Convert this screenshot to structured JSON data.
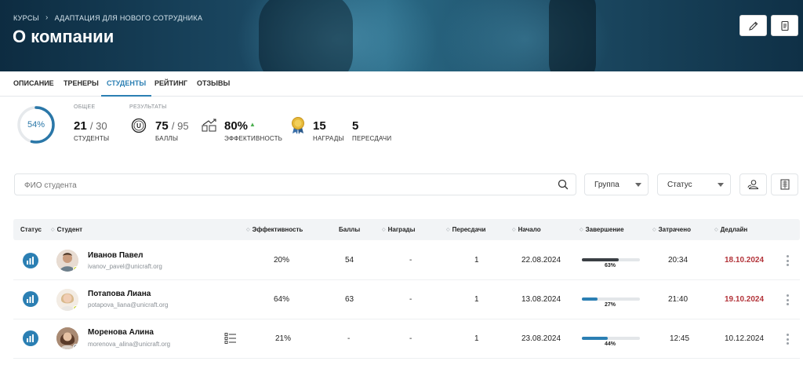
{
  "header": {
    "breadcrumb": [
      "КУРСЫ",
      "АДАПТАЦИЯ ДЛЯ НОВОГО СОТРУДНИКА"
    ],
    "title": "О компании",
    "edit_icon": "pencil-icon",
    "doc_icon": "document-icon"
  },
  "tabs": [
    {
      "label": "ОПИСАНИЕ"
    },
    {
      "label": "ТРЕНЕРЫ"
    },
    {
      "label": "СТУДЕНТЫ",
      "active": true
    },
    {
      "label": "РЕЙТИНГ"
    },
    {
      "label": "ОТЗЫВЫ"
    }
  ],
  "stats": {
    "progress_label": "54%",
    "progress_fraction": 0.54,
    "overall_caption": "ОБЩЕЕ",
    "results_caption": "РЕЗУЛЬТАТЫ",
    "students": {
      "value": "21",
      "total": "/ 30",
      "label": "СТУДЕНТЫ"
    },
    "points": {
      "value": "75",
      "total": "/ 95",
      "label": "БАЛЛЫ"
    },
    "efficiency": {
      "value": "80%",
      "label": "ЭФФЕКТИВНОСТЬ"
    },
    "awards": {
      "value": "15",
      "label": "НАГРАДЫ"
    },
    "retakes": {
      "value": "5",
      "label": "ПЕРЕСДАЧИ"
    }
  },
  "filters": {
    "search_placeholder": "ФИО студента",
    "group_label": "Группа",
    "status_label": "Статус"
  },
  "table": {
    "headers": {
      "status": "Статус",
      "student": "Студент",
      "efficiency": "Эффективность",
      "points": "Баллы",
      "awards": "Награды",
      "retakes": "Пересдачи",
      "start": "Начало",
      "completion": "Завершение",
      "spent": "Затрачено",
      "deadline": "Дедлайн"
    },
    "rows": [
      {
        "name": "Иванов Павел",
        "email": "ivanov_pavel@unicraft.org",
        "efficiency": "20%",
        "points": "54",
        "awards": "-",
        "retakes": "1",
        "start": "22.08.2024",
        "completion_label": "63%",
        "completion": 0.63,
        "spent": "20:34",
        "deadline": "18.10.2024",
        "deadline_overdue": true,
        "bar_color": "#3a3f44",
        "presence_color": "#c8d43a"
      },
      {
        "name": "Потапова Лиана",
        "email": "potapova_liana@unicraft.org",
        "efficiency": "64%",
        "points": "63",
        "awards": "-",
        "retakes": "1",
        "start": "13.08.2024",
        "completion_label": "27%",
        "completion": 0.27,
        "spent": "21:40",
        "deadline": "19.10.2024",
        "deadline_overdue": true,
        "bar_color": "#2b7fb3",
        "presence_color": "#c8d43a"
      },
      {
        "name": "Моренова Алина",
        "email": "morenova_alina@unicraft.org",
        "efficiency": "21%",
        "points": "-",
        "awards": "-",
        "retakes": "1",
        "start": "23.08.2024",
        "completion_label": "44%",
        "completion": 0.44,
        "spent": "12:45",
        "deadline": "10.12.2024",
        "deadline_overdue": false,
        "bar_color": "#2b7fb3",
        "presence_color": "#8a9096",
        "has_task_icon": true
      }
    ]
  },
  "colors": {
    "accent": "#2b7fb3",
    "overdue": "#b3343a",
    "up_arrow": "#4caf50"
  }
}
